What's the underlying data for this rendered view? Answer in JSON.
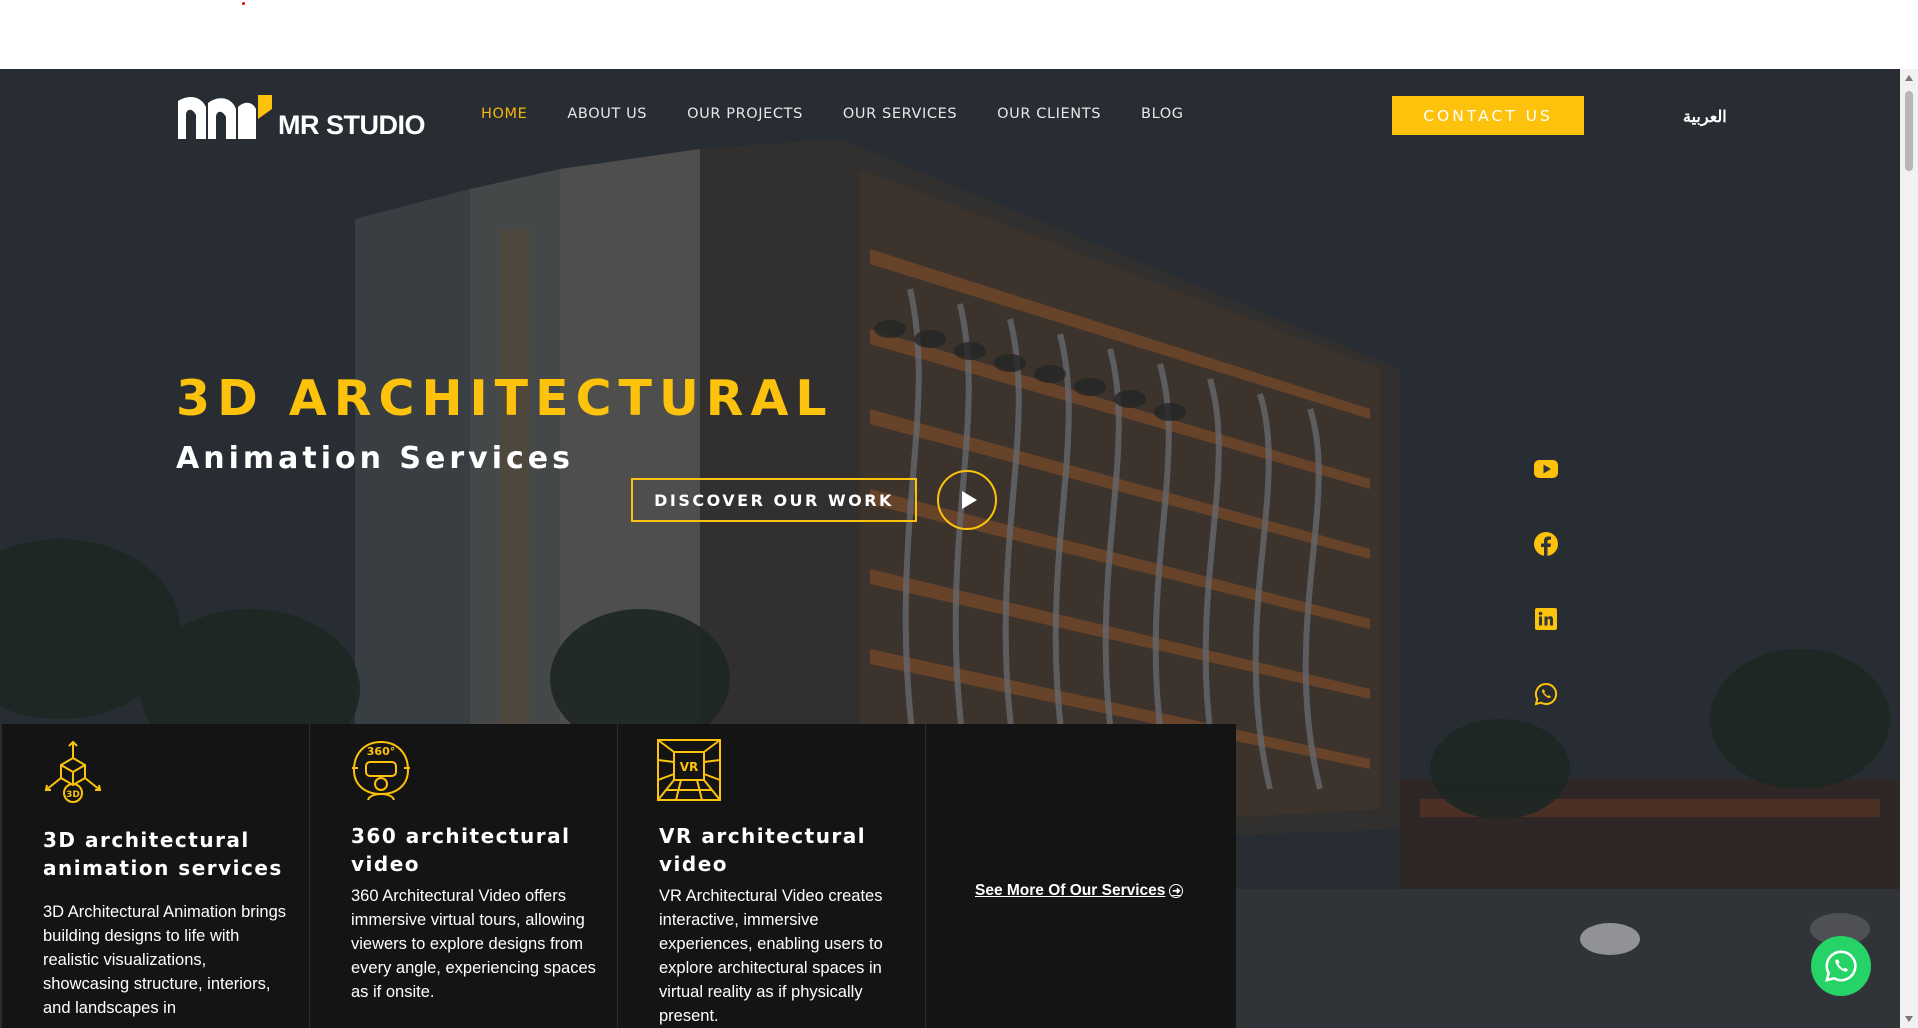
{
  "header": {
    "logo_text": "MR STUDIO",
    "nav": [
      "HOME",
      "ABOUT US",
      "OUR PROJECTS",
      "OUR SERVICES",
      "OUR CLIENTS",
      "BLOG"
    ],
    "active_nav": "HOME",
    "contact_label": "CONTACT US",
    "language_label": "العربية"
  },
  "hero": {
    "title": "3D ARCHITECTURAL",
    "subtitle": "Animation Services",
    "discover_label": "DISCOVER OUR WORK"
  },
  "social": [
    "youtube-icon",
    "facebook-icon",
    "linkedin-icon",
    "whatsapp-icon"
  ],
  "services": [
    {
      "icon": "3d-cube-icon",
      "title": "3D architectural animation services",
      "text": "3D Architectural Animation brings building designs to life with realistic visualizations, showcasing structure, interiors, and landscapes in"
    },
    {
      "icon": "360-vr-headset-icon",
      "title": "360 architectural video",
      "text": "360 Architectural Video offers immersive virtual tours, allowing viewers to explore designs from every angle, experiencing spaces as if onsite."
    },
    {
      "icon": "vr-room-icon",
      "title": "VR architectural video",
      "text": "VR Architectural Video creates interactive, immersive experiences, enabling users to explore architectural spaces in virtual reality as if physically present."
    }
  ],
  "see_more_label": "See More Of Our Services",
  "colors": {
    "accent": "#fdc20c",
    "card_bg": "#141414",
    "whatsapp": "#25d366"
  }
}
